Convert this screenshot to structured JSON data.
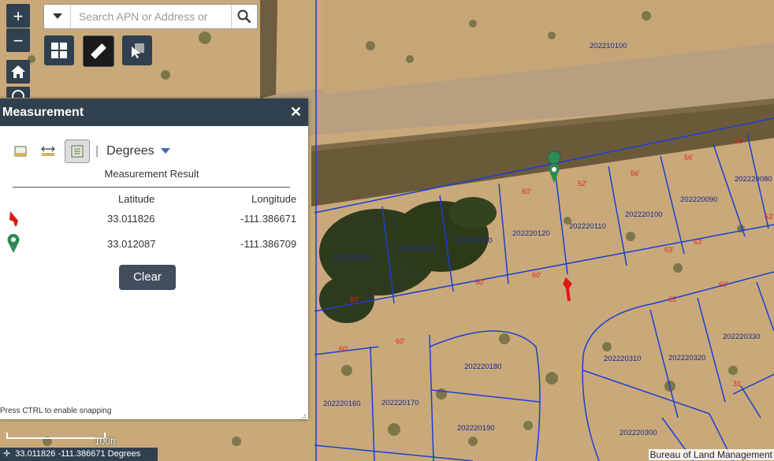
{
  "search": {
    "placeholder": "Search APN or Address or"
  },
  "zoom": {
    "in_label": "+",
    "out_label": "−"
  },
  "panel": {
    "title": "Measurement",
    "units": "Degrees",
    "result_title": "Measurement Result",
    "columns": [
      "Latitude",
      "Longitude"
    ],
    "rows": [
      {
        "marker": "red-flag",
        "latitude": "33.011826",
        "longitude": "-111.386671"
      },
      {
        "marker": "green-pin",
        "latitude": "33.012087",
        "longitude": "-111.386709"
      }
    ],
    "clear_label": "Clear",
    "snap_hint": "Press CTRL to enable snapping"
  },
  "scale": {
    "label": "100ft"
  },
  "coords_readout": "33.011826 -111.386671 Degrees",
  "attribution": "Bureau of Land Management",
  "parcels": [
    "202210100",
    "202220080",
    "202220090",
    "202220100",
    "202220110",
    "202220120",
    "202220130",
    "202220140",
    "202220150",
    "202220160",
    "202220170",
    "202220180",
    "202220190",
    "202220300",
    "202220310",
    "202220320",
    "202220330"
  ],
  "dimensions": [
    "56'",
    "56'",
    "56'",
    "52'",
    "60'",
    "63'",
    "63'",
    "63'",
    "60'",
    "60'",
    "60'",
    "83'",
    "60'",
    "55'",
    "60'",
    "31'"
  ],
  "colors": {
    "header": "#30404f",
    "parcel_line": "#1a3fd4",
    "parcel_text": "#1a2a8a",
    "dim_text": "#d22"
  }
}
